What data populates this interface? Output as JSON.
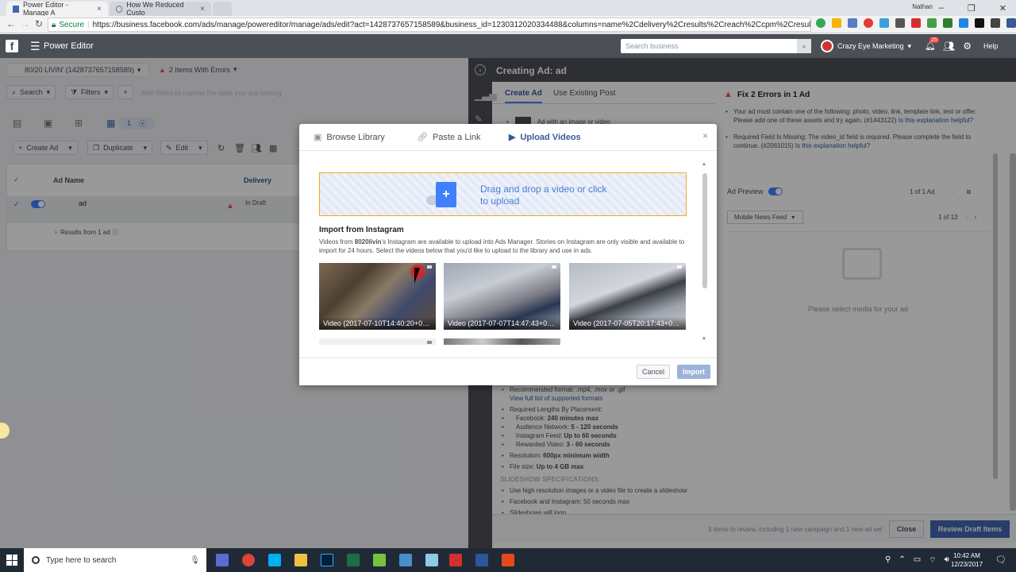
{
  "browser": {
    "tabs": [
      {
        "title": "Power Editor - Manage A"
      },
      {
        "title": "How We Reduced Custo"
      }
    ],
    "user": "Nathan",
    "secure_label": "Secure",
    "url": "https://business.facebook.com/ads/manage/powereditor/manage/ads/edit?act=1428737657158589&business_id=1230312020334488&columns=name%2Cdelivery%2Cresults%2Creach%2Ccpm%2Cresult_rate%2..."
  },
  "fb_bar": {
    "logo": "f",
    "title": "Power Editor",
    "search_placeholder": "Search business",
    "account": "Crazy Eye Marketing",
    "notif_count": "25",
    "help": "Help"
  },
  "left": {
    "account_selector": "80/20 LIVIN' (1428737657158589)",
    "errors_label": "2 Items With Errors",
    "search_label": "Search",
    "filters_label": "Filters",
    "filter_hint": "Add filters to narrow the data you are seeing",
    "selected_count": "1",
    "create_ad": "Create Ad",
    "duplicate": "Duplicate",
    "edit": "Edit",
    "col_ad_name": "Ad Name",
    "col_delivery": "Delivery",
    "row_name": "ad",
    "row_delivery": "In Draft",
    "results_row": "Results from 1 ad"
  },
  "right": {
    "header": "Creating Ad: ad",
    "tabs": [
      "Create Ad",
      "Use Existing Post"
    ],
    "format_option": "Ad with an image or video",
    "error_title": "Fix 2 Errors in 1 Ad",
    "error_1": "Your ad must contain one of the following: photo, video, link, template link, text or offer. Please add one of these assets and try again. (#1443122)",
    "error_1_link": "Is this explanation helpful?",
    "error_2": "Required Field Is Missing: The video_id field is required. Please complete the field to continue. (#2061015)",
    "error_2_link": "Is this explanation helpful?",
    "ad_preview": "Ad Preview",
    "pager_ads": "1 of 1 Ad",
    "placement": "Mobile News Feed",
    "pager_placement": "1 of 13",
    "select_media": "Please select media for your ad",
    "specs": {
      "recommended_format": "Recommended format: .mp4, .mov or .gif",
      "supported_link": "View full list of supported formats",
      "required_lengths": "Required Lengths By Placement:",
      "fb": "Facebook: ",
      "fb_val": "240 minutes max",
      "an": "Audience Network: ",
      "an_val": "5 - 120 seconds",
      "ig": "Instagram Feed: ",
      "ig_val": "Up to 60 seconds",
      "rv": "Rewarded Video: ",
      "rv_val": "3 - 60 seconds",
      "resolution": "Resolution: ",
      "resolution_val": "600px minimum width",
      "filesize": "File size: ",
      "filesize_val": "Up to 4 GB max",
      "slideshow_h": "Slideshow Specifications:",
      "ss1": "Use high resolution images or a video file to create a slideshow",
      "ss2": "Facebook and Instagram: 50 seconds max",
      "ss3": "Slideshows will loop"
    }
  },
  "footer": {
    "text": "3 items to review, including 1 new campaign and 1 new ad set",
    "close": "Close",
    "review": "Review Draft Items"
  },
  "modal": {
    "tabs": [
      "Browse Library",
      "Paste a Link",
      "Upload Videos"
    ],
    "close": "×",
    "dropzone_text": "Drag and drop a video or click to upload",
    "ig_title": "Import from Instagram",
    "ig_desc_pre": "Videos from ",
    "ig_account": "8020livin",
    "ig_desc_post": "'s Instagram are available to upload into Ads Manager. Stories on Instagram are only visible and available to import for 24 hours. Select the videos below that you'd like to upload to the library and use in ads.",
    "videos": [
      "Video (2017-07-10T14:40:20+0000)",
      "Video (2017-07-07T14:47:43+0000)",
      "Video (2017-07-05T20:17:43+0000)"
    ],
    "cancel": "Cancel",
    "import": "Import"
  },
  "taskbar": {
    "search_placeholder": "Type here to search",
    "time": "10:42 AM",
    "date": "12/23/2017"
  },
  "colors": {
    "fb_blue": "#4267b2",
    "link": "#365899",
    "error": "#e9573f",
    "toggle": "#4080ff"
  }
}
